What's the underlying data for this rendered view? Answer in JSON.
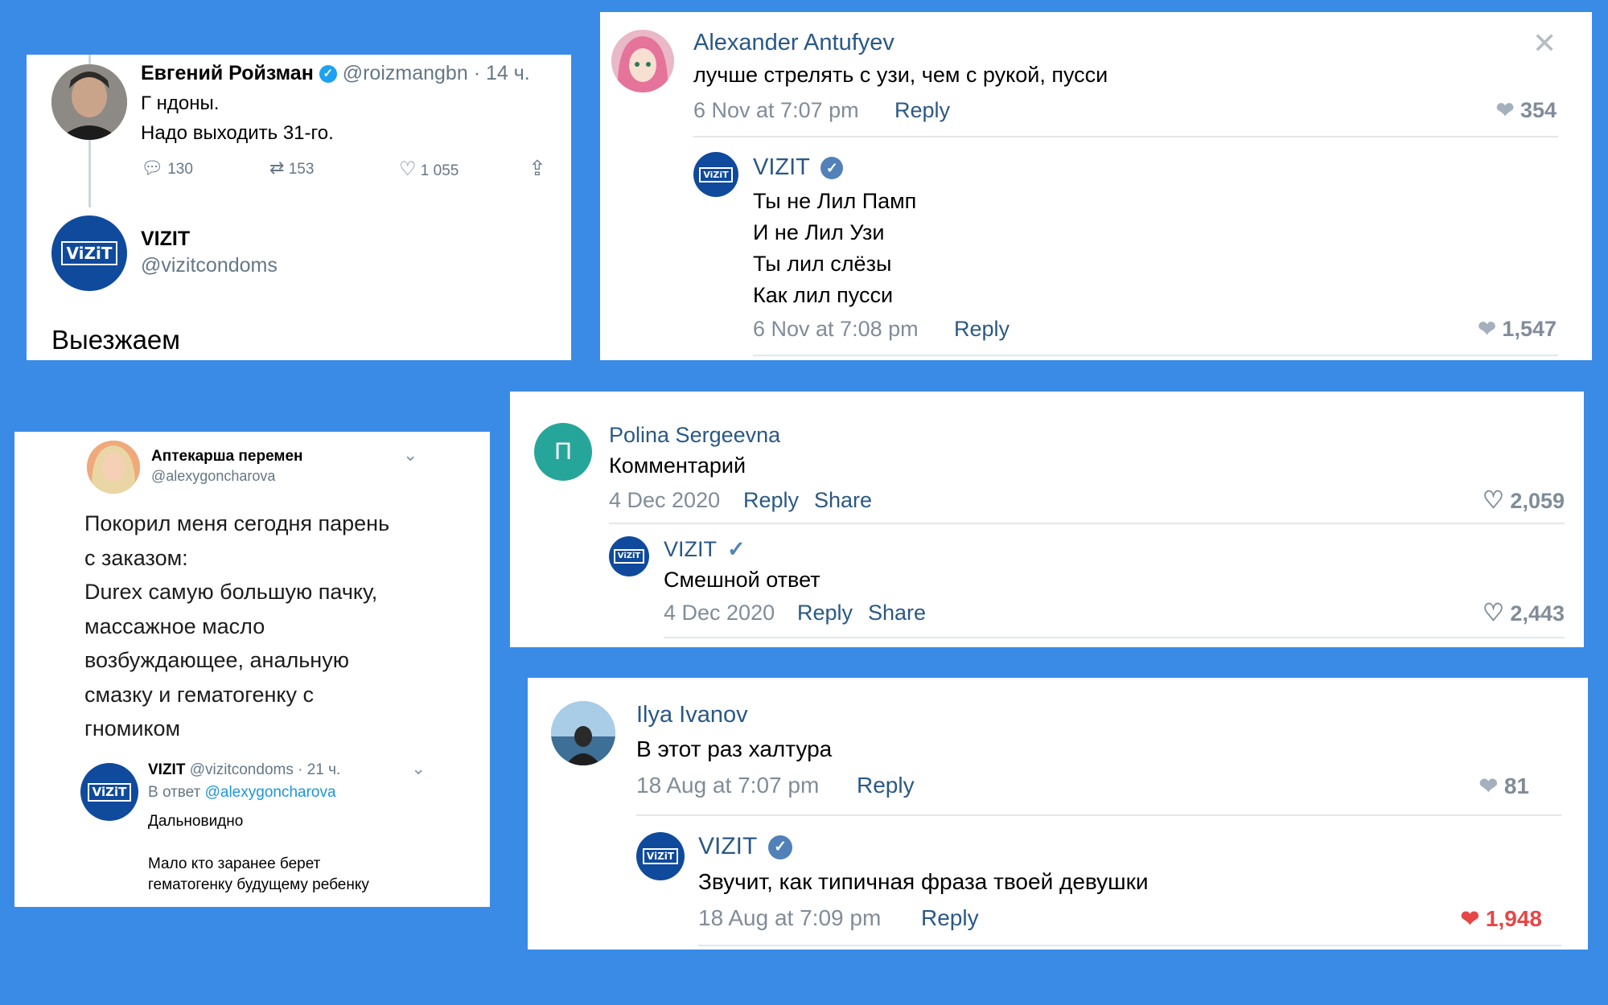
{
  "tweet1": {
    "author_name": "Евгений Ройзман",
    "author_handle": "@roizmangbn",
    "time": "· 14 ч.",
    "text_line1": "Г  ндоны.",
    "text_line2": "Надо выходить 31-го.",
    "replies": "130",
    "retweets": "153",
    "likes": "1 055",
    "reply_author": "VIZIT",
    "reply_handle": "@vizitcondoms",
    "reply_text": "Выезжаем",
    "logo_text": "ViZiT"
  },
  "vk1": {
    "author": "Alexander Antufyev",
    "text": "лучше стрелять с узи, чем с рукой, пусси",
    "date": "6 Nov at 7:07 pm",
    "reply_label": "Reply",
    "likes": "354",
    "reply_author": "VIZIT",
    "reply_lines": [
      "Ты не Лил Памп",
      "И не Лил Узи",
      "Ты лил слёзы",
      "Как лил пусси"
    ],
    "reply_date": "6 Nov at 7:08 pm",
    "reply_reply_label": "Reply",
    "reply_likes": "1,547",
    "logo_text": "ViZiT"
  },
  "tweet2": {
    "author_name": "Аптекарша перемен",
    "author_handle": "@alexygoncharova",
    "text_lines": [
      "Покорил меня сегодня парень",
      "с заказом:",
      "Durex самую большую пачку,",
      "массажное масло",
      "возбуждающее, анальную",
      "смазку и гематогенку с",
      "гномиком"
    ],
    "reply_author": "VIZIT",
    "reply_handle": "@vizitcondoms",
    "reply_time": "· 21 ч.",
    "reply_to_prefix": "В ответ",
    "reply_to_handle": "@alexygoncharova",
    "reply_line1": "Дальновидно",
    "reply_line2": "Мало кто заранее берет",
    "reply_line3": "гематогенку будущему ребенку",
    "logo_text": "ViZiT"
  },
  "vk2": {
    "avatar_letter": "П",
    "author": "Polina Sergeevna",
    "text": "Комментарий",
    "date": "4 Dec 2020",
    "reply_label": "Reply",
    "share_label": "Share",
    "likes": "2,059",
    "reply_author": "VIZIT",
    "reply_text": "Смешной ответ",
    "reply_date": "4 Dec 2020",
    "reply_reply_label": "Reply",
    "reply_share_label": "Share",
    "reply_likes": "2,443",
    "logo_text": "ViZiT"
  },
  "vk3": {
    "author": "Ilya Ivanov",
    "text": "В этот раз халтура",
    "date": "18 Aug at 7:07 pm",
    "reply_label": "Reply",
    "likes": "81",
    "reply_author": "VIZIT",
    "reply_text": "Звучит, как типичная фраза твоей девушки",
    "reply_date": "18 Aug at 7:09 pm",
    "reply_reply_label": "Reply",
    "reply_likes": "1,948",
    "logo_text": "ViZiT"
  },
  "colors": {
    "background": "#3a8be6",
    "vk_link": "#2a5885",
    "vk_grey": "#818c99",
    "twitter_blue": "#1b95e0",
    "vizit_blue": "#0f4a9c",
    "liked_red": "#e64646"
  }
}
